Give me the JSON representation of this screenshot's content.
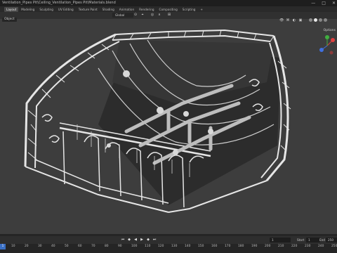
{
  "window": {
    "title": "Ventilation_Pipes Pit\\Ceiling_Ventilation_Pipes Pit\\Materials.blend",
    "controls": [
      "—",
      "□",
      "✕"
    ]
  },
  "tabs": [
    {
      "label": "Layout",
      "active": true
    },
    {
      "label": "Modeling",
      "active": false
    },
    {
      "label": "Sculpting",
      "active": false
    },
    {
      "label": "UV Editing",
      "active": false
    },
    {
      "label": "Texture Paint",
      "active": false
    },
    {
      "label": "Shading",
      "active": false
    },
    {
      "label": "Animation",
      "active": false
    },
    {
      "label": "Rendering",
      "active": false
    },
    {
      "label": "Compositing",
      "active": false
    },
    {
      "label": "Scripting",
      "active": false
    },
    {
      "label": "+",
      "active": false
    }
  ],
  "header": {
    "mode_label": "Object",
    "transform_orientation": "Global",
    "options_label": "Options"
  },
  "timeline": {
    "current_frame": "1",
    "start_label": "Start",
    "start_value": "1",
    "end_label": "End",
    "end_value": "250",
    "ruler_ticks": [
      "10",
      "20",
      "30",
      "40",
      "50",
      "60",
      "70",
      "80",
      "90",
      "100",
      "110",
      "120",
      "130",
      "140",
      "150",
      "160",
      "170",
      "180",
      "190",
      "200",
      "210",
      "220",
      "230",
      "240",
      "250"
    ]
  },
  "colors": {
    "viewport_bg": "#3d3d3d",
    "truss": "#e6e6e6",
    "accent_blue": "#3a6fc4"
  }
}
